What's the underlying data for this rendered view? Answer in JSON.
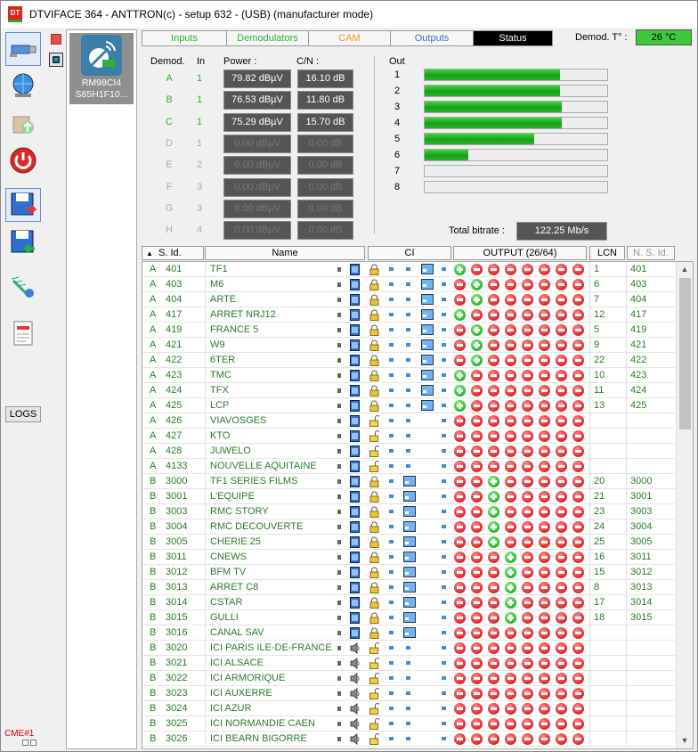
{
  "window": {
    "title": "DTVIFACE 364 - ANTTRON(c) - setup 632 - (USB) (manufacturer mode)",
    "app_icon_text": "DT"
  },
  "sidebar": {
    "logs_label": "LOGS",
    "cme_label": "CME#1"
  },
  "device": {
    "label": "RM98CI4\nS85H1F10..."
  },
  "tabs": [
    {
      "label": "Inputs",
      "color": "#2bb52b"
    },
    {
      "label": "Demodulators",
      "color": "#2bb52b"
    },
    {
      "label": "CAM",
      "color": "#f39c12"
    },
    {
      "label": "Outputs",
      "color": "#3a6fd8"
    },
    {
      "label": "Status",
      "active": true
    }
  ],
  "demod_temp": {
    "label": "Demod. T° :",
    "value": "26 °C"
  },
  "status": {
    "headers": {
      "demod": "Demod.",
      "in": "In",
      "power": "Power :",
      "cn": "C/N :",
      "out": "Out"
    },
    "demods": [
      {
        "letter": "A",
        "input": "1",
        "power": "79.82 dBµV",
        "cn": "16.10 dB",
        "active": true
      },
      {
        "letter": "B",
        "input": "1",
        "power": "76.53 dBµV",
        "cn": "11.80 dB",
        "active": true
      },
      {
        "letter": "C",
        "input": "1",
        "power": "75.29 dBµV",
        "cn": "15.70 dB",
        "active": true
      },
      {
        "letter": "D",
        "input": "1",
        "power": "0.00 dBµV",
        "cn": "0.00 dB",
        "active": false
      },
      {
        "letter": "E",
        "input": "2",
        "power": "0.00 dBµV",
        "cn": "0.00 dB",
        "active": false
      },
      {
        "letter": "F",
        "input": "3",
        "power": "0.00 dBµV",
        "cn": "0.00 dB",
        "active": false
      },
      {
        "letter": "G",
        "input": "3",
        "power": "0.00 dBµV",
        "cn": "0.00 dB",
        "active": false
      },
      {
        "letter": "H",
        "input": "4",
        "power": "0.00 dBµV",
        "cn": "0.00 dB",
        "active": false
      }
    ],
    "outputs": [
      {
        "num": "1",
        "level": 0.74
      },
      {
        "num": "2",
        "level": 0.74
      },
      {
        "num": "3",
        "level": 0.75
      },
      {
        "num": "4",
        "level": 0.75
      },
      {
        "num": "5",
        "level": 0.6
      },
      {
        "num": "6",
        "level": 0.24
      },
      {
        "num": "7",
        "level": 0
      },
      {
        "num": "8",
        "level": 0
      }
    ],
    "total_bitrate_label": "Total bitrate :",
    "total_bitrate": "122.25 Mb/s"
  },
  "grid": {
    "headers": {
      "sid": "S. Id.",
      "name": "Name",
      "ci": "CI",
      "output": "OUTPUT (26/64)",
      "lcn": "LCN",
      "nsid": "N. S. Id."
    },
    "rows": [
      {
        "demod": "A",
        "sid": "401",
        "name": "TF1",
        "type": "tv",
        "plus": 0,
        "lcn": "1",
        "nsid": "401"
      },
      {
        "demod": "A",
        "sid": "403",
        "name": "M6",
        "type": "tv",
        "plus": 1,
        "lcn": "6",
        "nsid": "403"
      },
      {
        "demod": "A",
        "sid": "404",
        "name": "ARTE",
        "type": "tv",
        "plus": 1,
        "lcn": "7",
        "nsid": "404"
      },
      {
        "demod": "A",
        "sid": "417",
        "name": "ARRET NRJ12",
        "type": "tv",
        "plus": 0,
        "lcn": "12",
        "nsid": "417"
      },
      {
        "demod": "A",
        "sid": "419",
        "name": "FRANCE 5",
        "type": "tv",
        "plus": 1,
        "lcn": "5",
        "nsid": "419"
      },
      {
        "demod": "A",
        "sid": "421",
        "name": "W9",
        "type": "tv",
        "plus": 1,
        "lcn": "9",
        "nsid": "421"
      },
      {
        "demod": "A",
        "sid": "422",
        "name": "6TER",
        "type": "tv",
        "plus": 1,
        "lcn": "22",
        "nsid": "422"
      },
      {
        "demod": "A",
        "sid": "423",
        "name": "TMC",
        "type": "tv",
        "plus": 0,
        "lcn": "10",
        "nsid": "423"
      },
      {
        "demod": "A",
        "sid": "424",
        "name": "TFX",
        "type": "tv",
        "plus": 0,
        "lcn": "11",
        "nsid": "424"
      },
      {
        "demod": "A",
        "sid": "425",
        "name": "LCP",
        "type": "tv",
        "plus": 0,
        "lcn": "13",
        "nsid": "425"
      },
      {
        "demod": "A",
        "sid": "426",
        "name": "VIAVOSGES",
        "type": "open",
        "plus": -1,
        "lcn": "",
        "nsid": ""
      },
      {
        "demod": "A",
        "sid": "427",
        "name": "KTO",
        "type": "open",
        "plus": -1,
        "lcn": "",
        "nsid": ""
      },
      {
        "demod": "A",
        "sid": "428",
        "name": "JUWELO",
        "type": "open",
        "plus": -1,
        "lcn": "",
        "nsid": ""
      },
      {
        "demod": "A",
        "sid": "4133",
        "name": "NOUVELLE AQUITAINE",
        "type": "open",
        "plus": -1,
        "lcn": "",
        "nsid": ""
      },
      {
        "demod": "B",
        "sid": "3000",
        "name": "TF1 SERIES FILMS",
        "type": "tv",
        "plus": 2,
        "lcn": "20",
        "nsid": "3000"
      },
      {
        "demod": "B",
        "sid": "3001",
        "name": "L'EQUIPE",
        "type": "tv",
        "plus": 2,
        "lcn": "21",
        "nsid": "3001"
      },
      {
        "demod": "B",
        "sid": "3003",
        "name": "RMC STORY",
        "type": "tv",
        "plus": 2,
        "lcn": "23",
        "nsid": "3003"
      },
      {
        "demod": "B",
        "sid": "3004",
        "name": "RMC DECOUVERTE",
        "type": "tv",
        "plus": 2,
        "lcn": "24",
        "nsid": "3004"
      },
      {
        "demod": "B",
        "sid": "3005",
        "name": "CHERIE 25",
        "type": "tv",
        "plus": 2,
        "lcn": "25",
        "nsid": "3005"
      },
      {
        "demod": "B",
        "sid": "3011",
        "name": "CNEWS",
        "type": "tv",
        "plus": 3,
        "lcn": "16",
        "nsid": "3011"
      },
      {
        "demod": "B",
        "sid": "3012",
        "name": "BFM TV",
        "type": "tv",
        "plus": 3,
        "lcn": "15",
        "nsid": "3012"
      },
      {
        "demod": "B",
        "sid": "3013",
        "name": "ARRET C8",
        "type": "tv",
        "plus": 3,
        "lcn": "8",
        "nsid": "3013"
      },
      {
        "demod": "B",
        "sid": "3014",
        "name": "CSTAR",
        "type": "tv",
        "plus": 3,
        "lcn": "17",
        "nsid": "3014"
      },
      {
        "demod": "B",
        "sid": "3015",
        "name": "GULLI",
        "type": "tv",
        "plus": 3,
        "lcn": "18",
        "nsid": "3015"
      },
      {
        "demod": "B",
        "sid": "3016",
        "name": "CANAL SAV",
        "type": "tv",
        "plus": -1,
        "lcn": "",
        "nsid": ""
      },
      {
        "demod": "B",
        "sid": "3020",
        "name": "ICI PARIS ILE-DE-FRANCE",
        "type": "radio",
        "plus": -1,
        "lcn": "",
        "nsid": ""
      },
      {
        "demod": "B",
        "sid": "3021",
        "name": "ICI ALSACE",
        "type": "radio",
        "plus": -1,
        "lcn": "",
        "nsid": ""
      },
      {
        "demod": "B",
        "sid": "3022",
        "name": "ICI ARMORIQUE",
        "type": "radio",
        "plus": -1,
        "lcn": "",
        "nsid": ""
      },
      {
        "demod": "B",
        "sid": "3023",
        "name": "ICI AUXERRE",
        "type": "radio",
        "plus": -1,
        "lcn": "",
        "nsid": ""
      },
      {
        "demod": "B",
        "sid": "3024",
        "name": "ICI AZUR",
        "type": "radio",
        "plus": -1,
        "lcn": "",
        "nsid": ""
      },
      {
        "demod": "B",
        "sid": "3025",
        "name": "ICI NORMANDIE CAEN",
        "type": "radio",
        "plus": -1,
        "lcn": "",
        "nsid": ""
      },
      {
        "demod": "B",
        "sid": "3026",
        "name": "ICI BEARN BIGORRE",
        "type": "radio",
        "plus": -1,
        "lcn": "",
        "nsid": ""
      }
    ]
  }
}
